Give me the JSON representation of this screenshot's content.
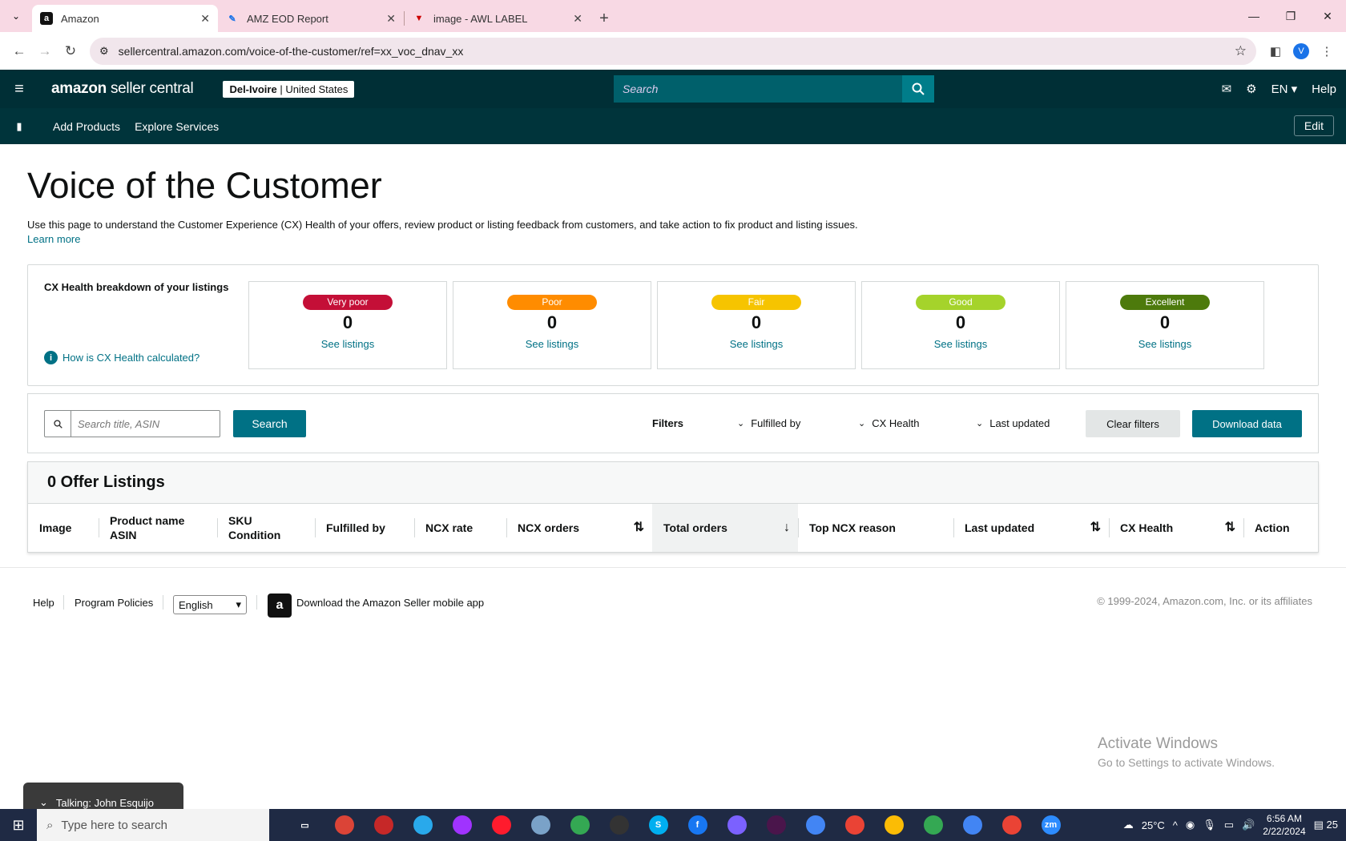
{
  "browser": {
    "tabs": [
      {
        "title": "Amazon",
        "active": true
      },
      {
        "title": "AMZ EOD Report",
        "active": false
      },
      {
        "title": "image - AWL LABEL",
        "active": false
      }
    ],
    "url": "sellercentral.amazon.com/voice-of-the-customer/ref=xx_voc_dnav_xx",
    "profile_initial": "V"
  },
  "header": {
    "logo_brand": "amazon",
    "logo_suffix": "seller central",
    "store_name": "Del-Ivoire",
    "store_region": "United States",
    "search_placeholder": "Search",
    "language": "EN",
    "help": "Help"
  },
  "subnav": {
    "items": [
      "Add Products",
      "Explore Services"
    ],
    "edit": "Edit"
  },
  "page": {
    "title": "Voice of the Customer",
    "description": "Use this page to understand the Customer Experience (CX) Health of your offers, review product or listing feedback from customers, and take action to fix product and listing issues.",
    "learn_more": "Learn more"
  },
  "cx_health": {
    "title": "CX Health breakdown of your listings",
    "how_link": "How is CX Health calculated?",
    "cards": [
      {
        "label": "Very poor",
        "count": "0",
        "link": "See listings",
        "color": "#c40f37"
      },
      {
        "label": "Poor",
        "count": "0",
        "link": "See listings",
        "color": "#ff8c00"
      },
      {
        "label": "Fair",
        "count": "0",
        "link": "See listings",
        "color": "#f6c400"
      },
      {
        "label": "Good",
        "count": "0",
        "link": "See listings",
        "color": "#a5d32b"
      },
      {
        "label": "Excellent",
        "count": "0",
        "link": "See listings",
        "color": "#4d7a0c"
      }
    ]
  },
  "filters": {
    "search_placeholder": "Search title, ASIN",
    "search_button": "Search",
    "label": "Filters",
    "dropdowns": [
      "Fulfilled by",
      "CX Health",
      "Last updated"
    ],
    "clear": "Clear filters",
    "download": "Download data"
  },
  "listings": {
    "heading": "0 Offer Listings",
    "columns": [
      {
        "line1": "Image",
        "line2": ""
      },
      {
        "line1": "Product name",
        "line2": "ASIN"
      },
      {
        "line1": "SKU",
        "line2": "Condition"
      },
      {
        "line1": "Fulfilled by",
        "line2": ""
      },
      {
        "line1": "NCX rate",
        "line2": ""
      },
      {
        "line1": "NCX orders",
        "line2": ""
      },
      {
        "line1": "Total orders",
        "line2": ""
      },
      {
        "line1": "Top NCX reason",
        "line2": ""
      },
      {
        "line1": "Last updated",
        "line2": ""
      },
      {
        "line1": "CX Health",
        "line2": ""
      },
      {
        "line1": "Action",
        "line2": ""
      }
    ]
  },
  "footer": {
    "help": "Help",
    "policies": "Program Policies",
    "language": "English",
    "app_text": "Download the Amazon Seller mobile app",
    "copyright": "© 1999-2024, Amazon.com, Inc. or its affiliates"
  },
  "watermark": {
    "line1": "Activate Windows",
    "line2": "Go to Settings to activate Windows."
  },
  "toast": {
    "text": "Talking: John Esquijo"
  },
  "taskbar": {
    "search_placeholder": "Type here to search",
    "weather": "25°C",
    "time": "6:56 AM",
    "date": "2/22/2024",
    "notif_count": "25"
  }
}
